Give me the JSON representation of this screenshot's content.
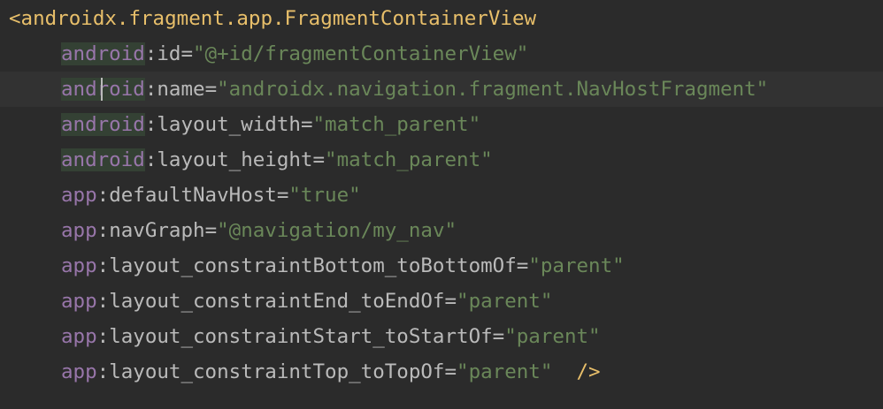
{
  "editor": {
    "tag_open": "<",
    "tag_name": "androidx.fragment.app.FragmentContainerView",
    "lines": [
      {
        "ns": "android",
        "attr": "id",
        "value": "\"@+id/fragmentContainerView\""
      },
      {
        "ns": "android",
        "attr": "name",
        "value": "\"androidx.navigation.fragment.NavHostFragment\""
      },
      {
        "ns": "android",
        "attr": "layout_width",
        "value": "\"match_parent\""
      },
      {
        "ns": "android",
        "attr": "layout_height",
        "value": "\"match_parent\""
      },
      {
        "ns": "app",
        "attr": "defaultNavHost",
        "value": "\"true\""
      },
      {
        "ns": "app",
        "attr": "navGraph",
        "value": "\"@navigation/my_nav\""
      },
      {
        "ns": "app",
        "attr": "layout_constraintBottom_toBottomOf",
        "value": "\"parent\""
      },
      {
        "ns": "app",
        "attr": "layout_constraintEnd_toEndOf",
        "value": "\"parent\""
      },
      {
        "ns": "app",
        "attr": "layout_constraintStart_toStartOf",
        "value": "\"parent\""
      },
      {
        "ns": "app",
        "attr": "layout_constraintTop_toTopOf",
        "value": "\"parent\""
      }
    ],
    "colon": ":",
    "equals": "=",
    "self_close": "/>"
  }
}
